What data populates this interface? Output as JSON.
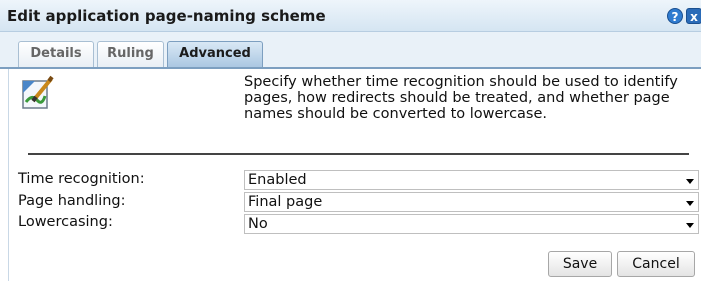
{
  "dialog": {
    "title": "Edit application page-naming scheme"
  },
  "titlebar_buttons": {
    "help_icon": "?",
    "close_icon": "x"
  },
  "tabs": [
    {
      "label": "Details",
      "active": false
    },
    {
      "label": "Ruling",
      "active": false
    },
    {
      "label": "Advanced",
      "active": true
    }
  ],
  "description": "Specify whether time recognition should be used to identify pages, how redirects should be treated, and whether page names should be converted to lowercase.",
  "fields": [
    {
      "label": "Time recognition:",
      "value": "Enabled"
    },
    {
      "label": "Page handling:",
      "value": "Final page"
    },
    {
      "label": "Lowercasing:",
      "value": "No"
    }
  ],
  "buttons": {
    "save": "Save",
    "cancel": "Cancel"
  },
  "colors": {
    "accent": "#2f7bd0",
    "active_tab": "#a9c6e1"
  }
}
